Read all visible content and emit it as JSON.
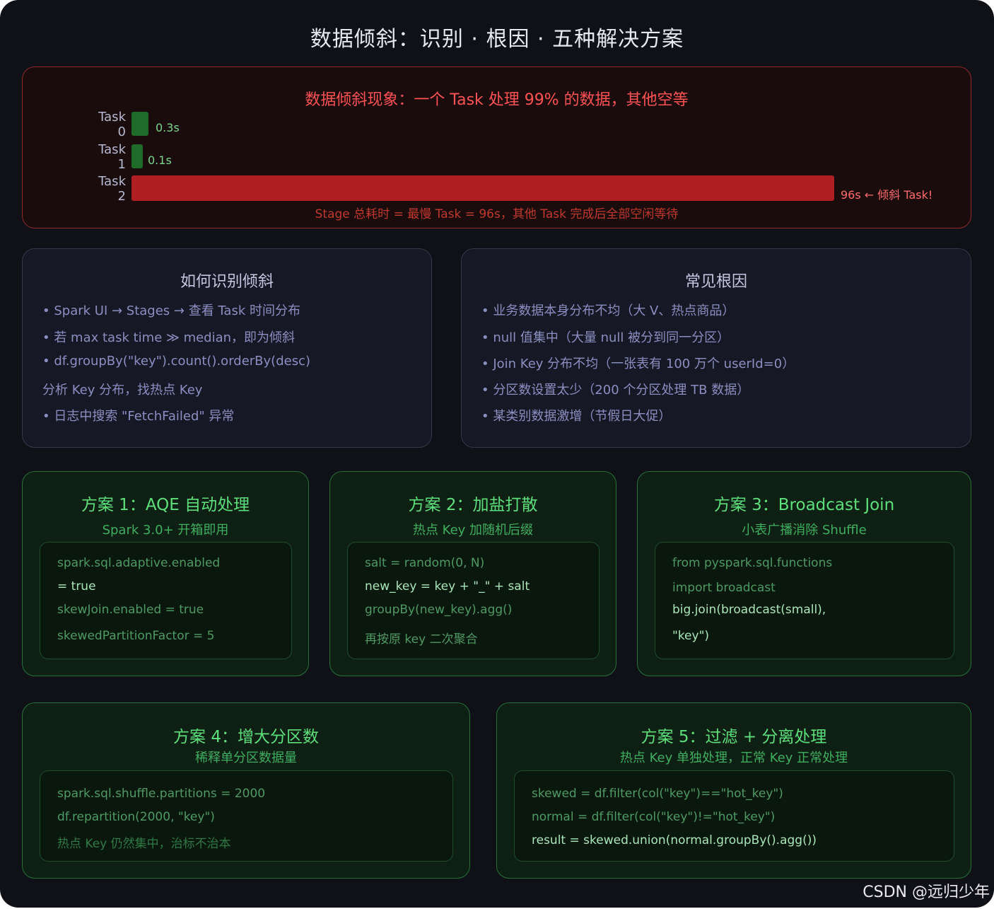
{
  "title": "数据倾斜：识别 · 根因 · 五种解决方案",
  "skew": {
    "title": "数据倾斜现象：一个 Task 处理 99% 的数据，其他空等",
    "tasks": [
      {
        "label": "Task 0",
        "value": "0.3s",
        "seconds": 0.3
      },
      {
        "label": "Task 1",
        "value": "0.1s",
        "seconds": 0.1
      },
      {
        "label": "Task 2",
        "value": "96s ← 倾斜 Task!",
        "seconds": 96
      }
    ],
    "note": "Stage 总耗时 = 最慢 Task = 96s，其他 Task 完成后全部空闲等待"
  },
  "identify": {
    "title": "如何识别倾斜",
    "lines": [
      "• Spark UI → Stages → 查看 Task 时间分布",
      "• 若 max task time ≫ median，即为倾斜",
      "• df.groupBy(\"key\").count().orderBy(desc)",
      "分析 Key 分布，找热点 Key",
      "• 日志中搜索 \"FetchFailed\" 异常"
    ]
  },
  "causes": {
    "title": "常见根因",
    "lines": [
      "• 业务数据本身分布不均（大 V、热点商品）",
      "• null 值集中（大量 null 被分到同一分区）",
      "• Join Key 分布不均（一张表有 100 万个 userId=0）",
      "• 分区数设置太少（200 个分区处理 TB 数据）",
      "• 某类别数据激增（节假日大促）"
    ]
  },
  "solutions": [
    {
      "title": "方案 1：AQE 自动处理",
      "subtitle": "Spark 3.0+ 开箱即用",
      "code": [
        "spark.sql.adaptive.enabled",
        "= true",
        "skewJoin.enabled = true",
        "skewedPartitionFactor = 5"
      ]
    },
    {
      "title": "方案 2：加盐打散",
      "subtitle": "热点 Key 加随机后缀",
      "code": [
        "salt = random(0, N)",
        "new_key = key + \"_\" + salt",
        "groupBy(new_key).agg()",
        "再按原 key 二次聚合"
      ]
    },
    {
      "title": "方案 3：Broadcast Join",
      "subtitle": "小表广播消除 Shuffle",
      "code": [
        "from pyspark.sql.functions",
        "import broadcast",
        "big.join(broadcast(small),",
        "\"key\")"
      ]
    },
    {
      "title": "方案 4：增大分区数",
      "subtitle": "稀释单分区数据量",
      "code": [
        "spark.sql.shuffle.partitions = 2000",
        "df.repartition(2000, \"key\")",
        "热点 Key 仍然集中，治标不治本"
      ]
    },
    {
      "title": "方案 5：过滤 + 分离处理",
      "subtitle": "热点 Key 单独处理，正常 Key 正常处理",
      "code": [
        "skewed = df.filter(col(\"key\")==\"hot_key\")",
        "normal = df.filter(col(\"key\")!=\"hot_key\")",
        "result = skewed.union(normal.groupBy().agg())"
      ]
    }
  ],
  "watermark": "CSDN @远归少年"
}
